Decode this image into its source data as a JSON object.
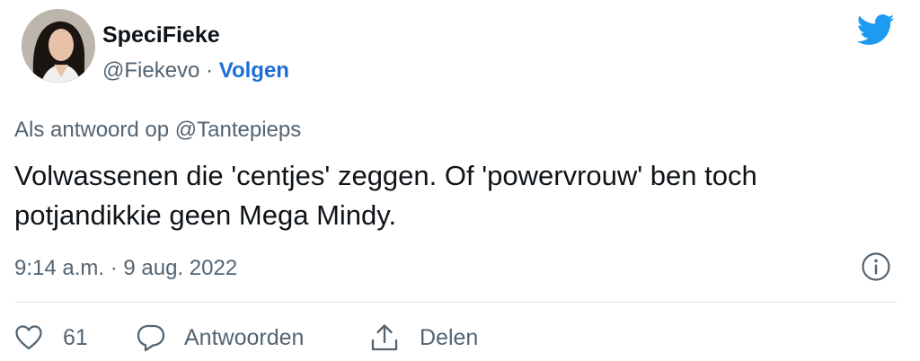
{
  "author": {
    "display_name": "SpeciFieke",
    "handle": "@Fiekevo",
    "separator": " · ",
    "follow_label": "Volgen"
  },
  "tweet": {
    "reply_to": "Als antwoord op @Tantepieps",
    "text": "Volwassenen die 'centjes' zeggen. Of 'powervrouw' ben toch potjandikkie geen Mega Mindy.",
    "timestamp": "9:14 a.m. · 9 aug. 2022"
  },
  "actions": {
    "like_count": "61",
    "reply_label": "Antwoorden",
    "share_label": "Delen"
  },
  "colors": {
    "brand": "#1d9bf0",
    "link": "#1d6fd6",
    "secondary_text": "#536471"
  },
  "icons": {
    "brand": "twitter-bird-icon",
    "info": "info-icon",
    "like": "heart-icon",
    "reply": "speech-bubble-icon",
    "share": "share-icon"
  }
}
